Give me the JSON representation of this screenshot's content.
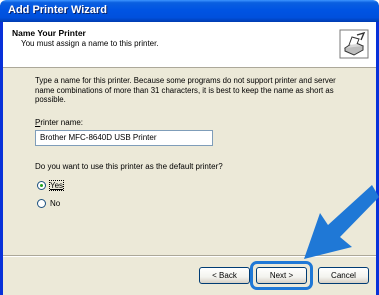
{
  "window": {
    "title": "Add Printer Wizard"
  },
  "header": {
    "title": "Name Your Printer",
    "subtitle": "You must assign a name to this printer.",
    "icon": "printer-wizard-icon"
  },
  "body": {
    "description": "Type a name for this printer. Because some programs do not support printer and server name combinations of more than 31 characters, it is best to keep the name as short as possible."
  },
  "printer_name": {
    "label": "Printer name:",
    "value": "Brother MFC-8640D USB Printer"
  },
  "default_printer": {
    "question": "Do you want to use this printer as the default printer?",
    "options": [
      {
        "label": "Yes",
        "selected": true
      },
      {
        "label": "No",
        "selected": false
      }
    ]
  },
  "buttons": {
    "back": "< Back",
    "next": "Next >",
    "cancel": "Cancel"
  },
  "colors": {
    "title_bar": "#0054e3",
    "highlight": "#1f78d6"
  }
}
